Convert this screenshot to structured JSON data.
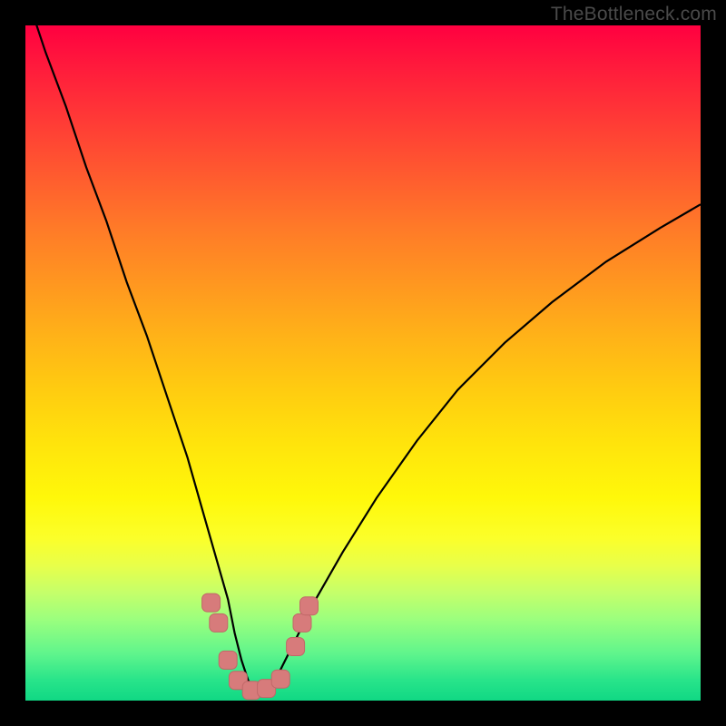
{
  "watermark": "TheBottleneck.com",
  "colors": {
    "frame": "#000000",
    "curve": "#000000",
    "marker_fill": "#d77b7b",
    "marker_stroke": "#c06868",
    "gradient_top": "#ff0040",
    "gradient_bottom": "#10d884"
  },
  "chart_data": {
    "type": "line",
    "title": "",
    "xlabel": "",
    "ylabel": "",
    "xlim": [
      0,
      100
    ],
    "ylim": [
      0,
      100
    ],
    "note": "Axes are unlabeled and unnumbered in the image; values are estimated percentages. The V-shaped curve touches ~0 near x≈33, with red markers around the trough on a rainbow background.",
    "series": [
      {
        "name": "bottleneck-curve",
        "x": [
          0,
          3,
          6,
          9,
          12,
          15,
          18,
          21,
          24,
          26,
          28,
          30,
          31,
          32,
          33,
          34,
          35,
          36,
          37,
          38,
          40,
          43,
          47,
          52,
          58,
          64,
          71,
          78,
          86,
          94,
          100
        ],
        "y": [
          105,
          96,
          88,
          79,
          71,
          62,
          54,
          45,
          36,
          29,
          22,
          15,
          10,
          6,
          3,
          1.5,
          1,
          1.5,
          3,
          5,
          9,
          15,
          22,
          30,
          38.5,
          46,
          53,
          59,
          65,
          70,
          73.5
        ]
      }
    ],
    "markers": [
      {
        "x": 27.5,
        "y": 14.5
      },
      {
        "x": 28.6,
        "y": 11.5
      },
      {
        "x": 30.0,
        "y": 6.0
      },
      {
        "x": 31.5,
        "y": 3.0
      },
      {
        "x": 33.5,
        "y": 1.5
      },
      {
        "x": 35.7,
        "y": 1.8
      },
      {
        "x": 37.8,
        "y": 3.2
      },
      {
        "x": 40.0,
        "y": 8.0
      },
      {
        "x": 41.0,
        "y": 11.5
      },
      {
        "x": 42.0,
        "y": 14.0
      }
    ]
  }
}
